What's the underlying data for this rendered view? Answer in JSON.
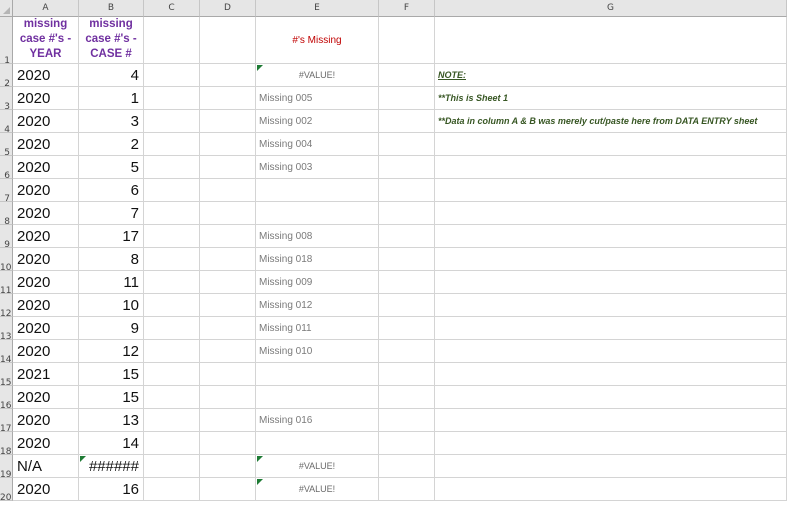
{
  "columns": [
    "A",
    "B",
    "C",
    "D",
    "E",
    "F",
    "G"
  ],
  "rows": [
    "1",
    "2",
    "3",
    "4",
    "5",
    "6",
    "7",
    "8",
    "9",
    "10",
    "11",
    "12",
    "13",
    "14",
    "15",
    "16",
    "17",
    "18",
    "19",
    "20"
  ],
  "header_row": {
    "a_lines": [
      "missing",
      "case #'s -",
      "YEAR"
    ],
    "b_lines": [
      "missing",
      "case #'s -",
      "CASE #"
    ],
    "e": "#'s Missing"
  },
  "data": [
    {
      "year": "2020",
      "case": "4",
      "missing": "#VALUE!",
      "flag_a": false,
      "flag_e": true,
      "note": "NOTE:"
    },
    {
      "year": "2020",
      "case": "1",
      "missing": "Missing 005",
      "flag_a": false,
      "flag_e": false,
      "note": "**This is Sheet 1"
    },
    {
      "year": "2020",
      "case": "3",
      "missing": "Missing 002",
      "flag_a": false,
      "flag_e": false,
      "note": "**Data in column A & B was merely cut/paste here from DATA ENTRY sheet"
    },
    {
      "year": "2020",
      "case": "2",
      "missing": "Missing 004",
      "flag_a": false,
      "flag_e": false,
      "note": ""
    },
    {
      "year": "2020",
      "case": "5",
      "missing": "Missing 003",
      "flag_a": false,
      "flag_e": false,
      "note": ""
    },
    {
      "year": "2020",
      "case": "6",
      "missing": "",
      "flag_a": false,
      "flag_e": false,
      "note": ""
    },
    {
      "year": "2020",
      "case": "7",
      "missing": "",
      "flag_a": false,
      "flag_e": false,
      "note": ""
    },
    {
      "year": "2020",
      "case": "17",
      "missing": "Missing 008",
      "flag_a": false,
      "flag_e": false,
      "note": ""
    },
    {
      "year": "2020",
      "case": "8",
      "missing": "Missing 018",
      "flag_a": false,
      "flag_e": false,
      "note": ""
    },
    {
      "year": "2020",
      "case": "11",
      "missing": "Missing 009",
      "flag_a": false,
      "flag_e": false,
      "note": ""
    },
    {
      "year": "2020",
      "case": "10",
      "missing": "Missing 012",
      "flag_a": false,
      "flag_e": false,
      "note": ""
    },
    {
      "year": "2020",
      "case": "9",
      "missing": "Missing 011",
      "flag_a": false,
      "flag_e": false,
      "note": ""
    },
    {
      "year": "2020",
      "case": "12",
      "missing": "Missing 010",
      "flag_a": false,
      "flag_e": false,
      "note": ""
    },
    {
      "year": "2021",
      "case": "15",
      "missing": "",
      "flag_a": false,
      "flag_e": false,
      "note": ""
    },
    {
      "year": "2020",
      "case": "15",
      "missing": "",
      "flag_a": false,
      "flag_e": false,
      "note": ""
    },
    {
      "year": "2020",
      "case": "13",
      "missing": "Missing 016",
      "flag_a": false,
      "flag_e": false,
      "note": ""
    },
    {
      "year": "2020",
      "case": "14",
      "missing": "",
      "flag_a": false,
      "flag_e": false,
      "note": ""
    },
    {
      "year": "N/A",
      "case": "######",
      "missing": "#VALUE!",
      "flag_a": true,
      "flag_e": true,
      "note": ""
    },
    {
      "year": "2020",
      "case": "16",
      "missing": "#VALUE!",
      "flag_a": false,
      "flag_e": true,
      "note": ""
    }
  ],
  "colors": {
    "header_purple": "#7030a0",
    "header_red": "#c00000",
    "note_green": "#375623",
    "error_triangle": "#1e7b34"
  }
}
